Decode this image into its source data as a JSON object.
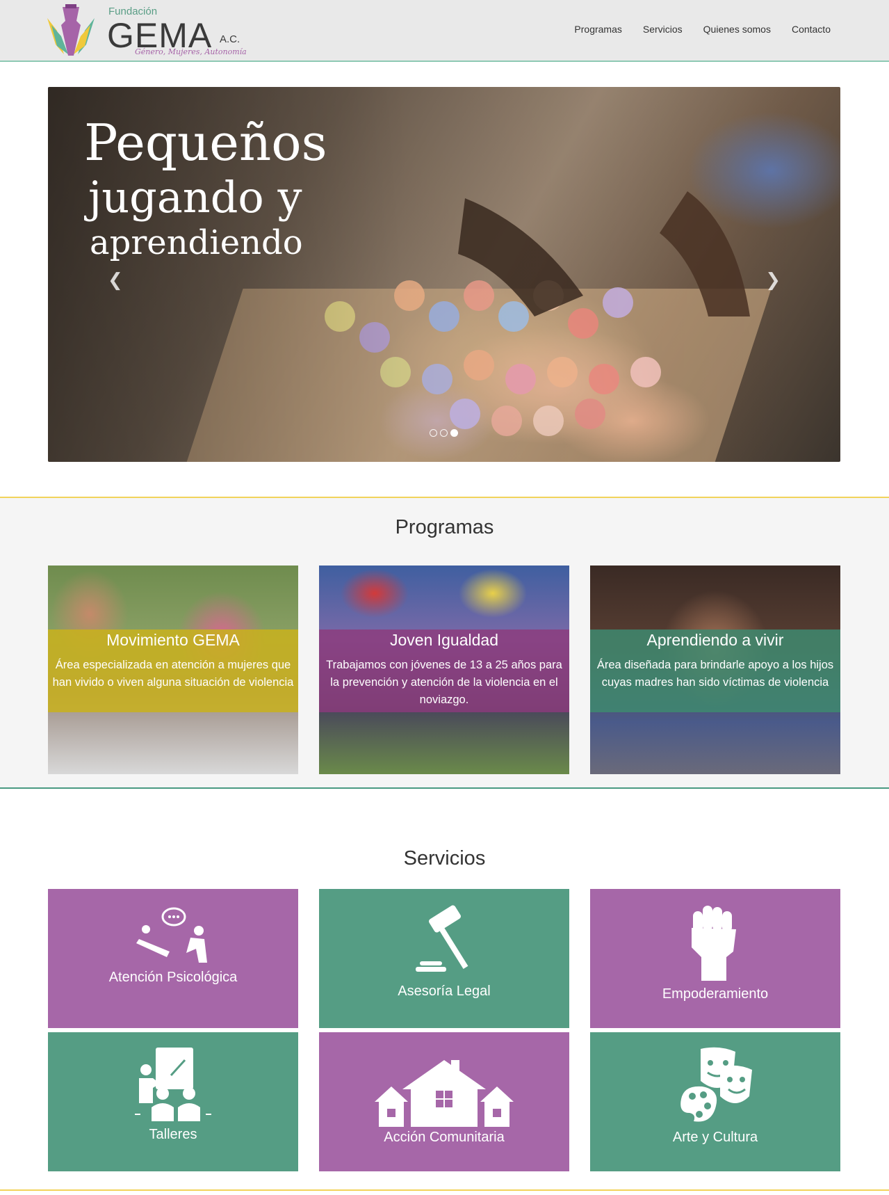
{
  "header": {
    "logo": {
      "foundation": "Fundación",
      "name": "GEMA",
      "suffix": "A.C.",
      "tagline": "Género, Mujeres, Autonomía"
    },
    "nav": [
      "Programas",
      "Servicios",
      "Quienes somos",
      "Contacto"
    ]
  },
  "hero": {
    "line1": "Pequeños",
    "line2": "jugando y",
    "line3": "aprendiendo",
    "prev_icon": "chevron-left-icon",
    "next_icon": "chevron-right-icon",
    "slides_total": 3,
    "active_slide": 3
  },
  "programas": {
    "title": "Programas",
    "cards": [
      {
        "title": "Movimiento GEMA",
        "text": "Área especializada en atención a mujeres que han vivido o viven alguna situación de violencia",
        "band_color": "#c9b11c"
      },
      {
        "title": "Joven Igualdad",
        "text": "Trabajamos con jóvenes de 13 a 25 años para la prevención y atención de la violencia en el noviazgo.",
        "band_color": "#8c3a7d"
      },
      {
        "title": "Aprendiendo a vivir",
        "text": "Área diseñada para brindarle apoyo a los hijos cuyas madres han sido víctimas de violencia",
        "band_color": "#3e8a70"
      }
    ]
  },
  "servicios": {
    "title": "Servicios",
    "items": [
      {
        "label": "Atención Psicológica",
        "icon": "therapy-icon",
        "color": "#a667a8"
      },
      {
        "label": "Asesoría Legal",
        "icon": "gavel-icon",
        "color": "#559d84"
      },
      {
        "label": "Empoderamiento",
        "icon": "fist-icon",
        "color": "#a667a8"
      },
      {
        "label": "Talleres",
        "icon": "teacher-icon",
        "color": "#559d84"
      },
      {
        "label": "Acción Comunitaria",
        "icon": "houses-icon",
        "color": "#a667a8"
      },
      {
        "label": "Arte y Cultura",
        "icon": "theater-masks-icon",
        "color": "#559d84"
      }
    ]
  }
}
